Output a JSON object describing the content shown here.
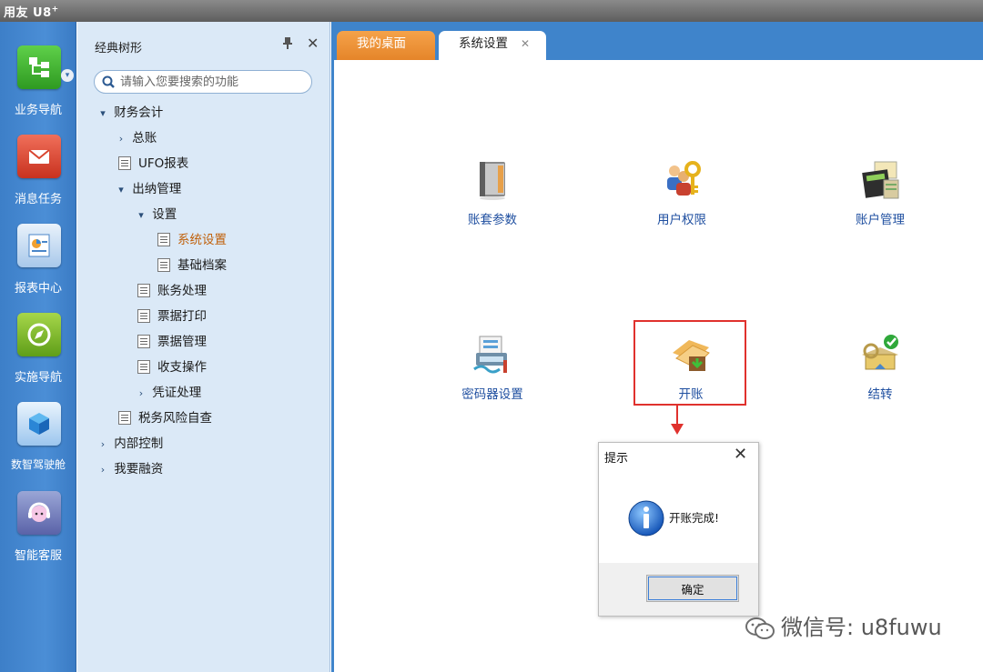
{
  "titlebar": {
    "app_name": "用友 U8",
    "app_superscript": "+"
  },
  "rail": {
    "items": [
      {
        "label": "业务导航",
        "icon": "business-navigation-icon"
      },
      {
        "label": "消息任务",
        "icon": "message-task-icon"
      },
      {
        "label": "报表中心",
        "icon": "report-center-icon"
      },
      {
        "label": "实施导航",
        "icon": "implementation-navigation-icon"
      },
      {
        "label": "数智驾驶舱",
        "icon": "digital-cockpit-icon"
      },
      {
        "label": "智能客服",
        "icon": "smart-customer-service-icon"
      }
    ]
  },
  "tree": {
    "title": "经典树形",
    "search_placeholder": "请输入您要搜索的功能",
    "items": [
      {
        "label": "财务会计",
        "state": "expanded"
      },
      {
        "label": "总账",
        "state": "collapsed"
      },
      {
        "label": "UFO报表",
        "state": "leaf"
      },
      {
        "label": "出纳管理",
        "state": "expanded"
      },
      {
        "label": "设置",
        "state": "expanded"
      },
      {
        "label": "系统设置",
        "state": "selected"
      },
      {
        "label": "基础档案",
        "state": "leaf"
      },
      {
        "label": "账务处理",
        "state": "leaf"
      },
      {
        "label": "票据打印",
        "state": "leaf"
      },
      {
        "label": "票据管理",
        "state": "leaf"
      },
      {
        "label": "收支操作",
        "state": "leaf"
      },
      {
        "label": "凭证处理",
        "state": "collapsed"
      },
      {
        "label": "税务风险自查",
        "state": "leaf"
      },
      {
        "label": "内部控制",
        "state": "collapsed"
      },
      {
        "label": "我要融资",
        "state": "collapsed"
      }
    ]
  },
  "tabs": [
    {
      "label": "我的桌面",
      "active": false
    },
    {
      "label": "系统设置",
      "active": true
    }
  ],
  "functions": [
    {
      "label": "账套参数",
      "icon": "account-book-icon"
    },
    {
      "label": "用户权限",
      "icon": "user-permission-icon"
    },
    {
      "label": "账户管理",
      "icon": "account-management-icon"
    },
    {
      "label": "密码器设置",
      "icon": "password-device-icon"
    },
    {
      "label": "开账",
      "icon": "open-account-icon"
    },
    {
      "label": "结转",
      "icon": "carry-forward-icon"
    }
  ],
  "dialog": {
    "title": "提示",
    "message": "开账完成!",
    "ok_label": "确定"
  },
  "watermark": {
    "text": "微信号: u8fuwu"
  },
  "colors": {
    "rail_blue": "#3d7fc8",
    "tab_orange": "#e5852a",
    "highlight_red": "#e0312d",
    "link_blue": "#1f4fa0",
    "selected_orange": "#c0600a"
  }
}
